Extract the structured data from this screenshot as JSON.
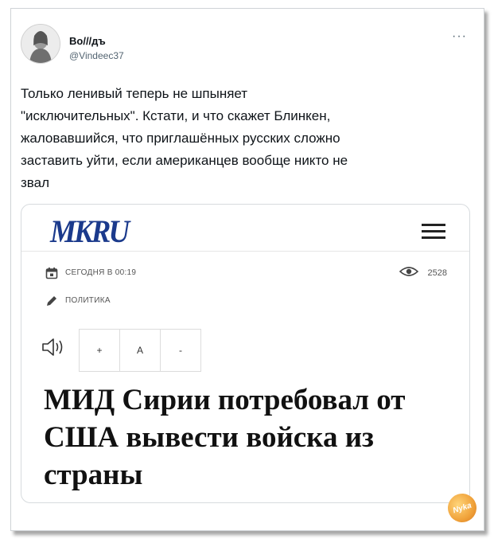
{
  "tweet": {
    "author_name": "Во///дъ",
    "author_handle": "@Vindeec37",
    "more_label": "···",
    "text": "Только ленивый теперь не шпыняет\n\"исключительных\". Кстати, и что скажет Блинкен,\nжаловавшийся, что приглашённых русских сложно\nзаставить уйти, если американцев вообще никто не\nзвал"
  },
  "article": {
    "logo": "MKRU",
    "date": "СЕГОДНЯ В 00:19",
    "category": "ПОЛИТИКА",
    "views": "2528",
    "font_controls": [
      "+",
      "A",
      "-"
    ],
    "headline": "МИД Сирии потребовал от США вывести войска из страны"
  },
  "watermark": {
    "text": "Nyka"
  },
  "colors": {
    "logo": "#1b3a8c",
    "border": "#d7dbde",
    "muted": "#536471"
  },
  "icons": {
    "calendar": "calendar-icon",
    "pencil": "pencil-icon",
    "eye": "eye-icon",
    "speaker": "speaker-icon",
    "menu": "hamburger-menu-icon"
  }
}
